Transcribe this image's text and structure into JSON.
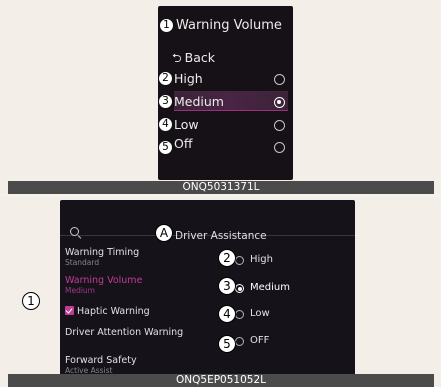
{
  "top": {
    "title": "Warning Volume",
    "back_label": "Back",
    "back_icon": "return-arrow-icon",
    "callouts": [
      "1",
      "2",
      "3",
      "4",
      "5"
    ],
    "options": [
      {
        "label": "High",
        "selected": false
      },
      {
        "label": "Medium",
        "selected": true
      },
      {
        "label": "Low",
        "selected": false
      },
      {
        "label": "Off",
        "selected": false
      }
    ],
    "caption": "ONQ5031371L"
  },
  "bottom": {
    "title": "Driver Assistance",
    "title_callout": "A",
    "search_icon": "search-icon",
    "callouts": [
      "1",
      "2",
      "3",
      "4",
      "5"
    ],
    "menu": [
      {
        "label": "Warning Timing",
        "sub": "Standard",
        "active": false
      },
      {
        "label": "Warning Volume",
        "sub": "Medium",
        "active": true
      },
      {
        "label": "Haptic Warning",
        "sub": "",
        "checked": true
      },
      {
        "label": "Driver Attention Warning",
        "sub": ""
      },
      {
        "label": "Forward Safety",
        "sub": "Active Assist"
      }
    ],
    "options": [
      {
        "label": "High",
        "selected": false
      },
      {
        "label": "Medium",
        "selected": true
      },
      {
        "label": "Low",
        "selected": false
      },
      {
        "label": "OFF",
        "selected": false
      }
    ],
    "caption": "ONQ5EP051052L"
  },
  "colors": {
    "accent": "#c23c94",
    "screen_bg": "#161116",
    "caption_bar": "#4b4b4b"
  }
}
